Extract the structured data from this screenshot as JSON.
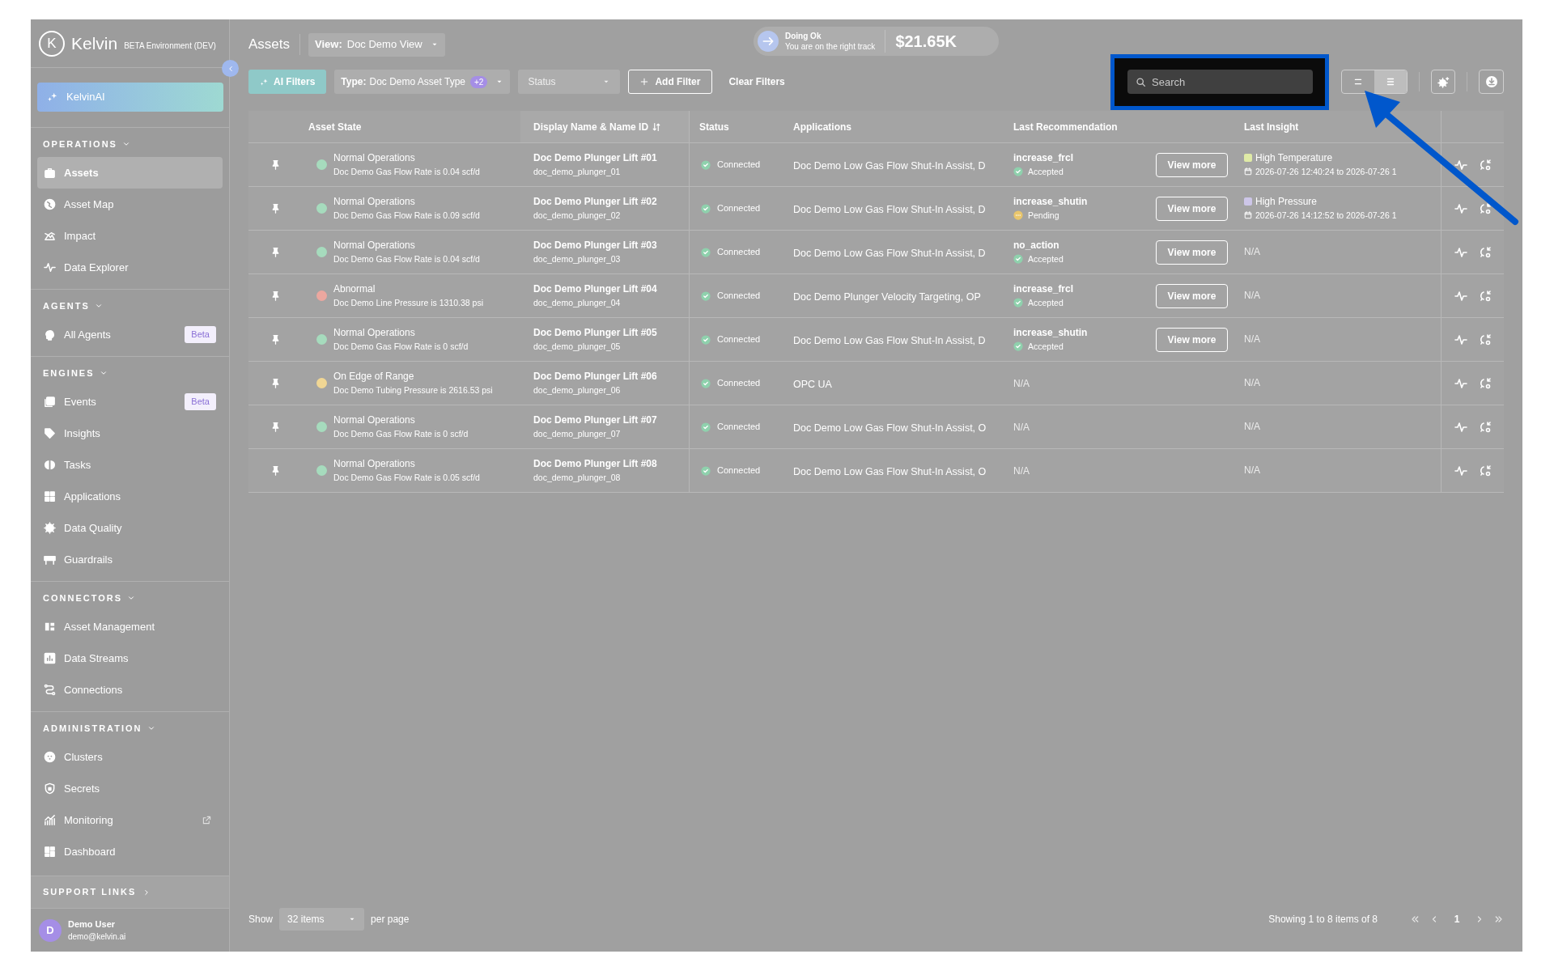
{
  "sidebar": {
    "logo": {
      "letter": "K",
      "name": "Kelvin",
      "environment": "BETA Environment (DEV)"
    },
    "ai_button": "KelvinAI",
    "sections": [
      {
        "title": "OPERATIONS",
        "items": [
          {
            "label": "Assets",
            "selected": true,
            "external": false
          },
          {
            "label": "Asset Map",
            "selected": false,
            "external": false
          },
          {
            "label": "Impact",
            "selected": false,
            "external": false
          },
          {
            "label": "Data Explorer",
            "selected": false,
            "external": false
          }
        ]
      },
      {
        "title": "AGENTS",
        "items": [
          {
            "label": "All Agents",
            "selected": false,
            "external": false,
            "badge": "Beta"
          }
        ]
      },
      {
        "title": "ENGINES",
        "items": [
          {
            "label": "Events",
            "selected": false,
            "external": false,
            "badge": "Beta"
          },
          {
            "label": "Insights",
            "selected": false,
            "external": false
          },
          {
            "label": "Tasks",
            "selected": false,
            "external": false
          },
          {
            "label": "Applications",
            "selected": false,
            "external": false
          },
          {
            "label": "Data Quality",
            "selected": false,
            "external": false
          },
          {
            "label": "Guardrails",
            "selected": false,
            "external": false
          }
        ]
      },
      {
        "title": "CONNECTORS",
        "items": [
          {
            "label": "Asset Management",
            "selected": false,
            "external": false
          },
          {
            "label": "Data Streams",
            "selected": false,
            "external": false
          },
          {
            "label": "Connections",
            "selected": false,
            "external": false
          }
        ]
      },
      {
        "title": "ADMINISTRATION",
        "items": [
          {
            "label": "Clusters",
            "selected": false,
            "external": false
          },
          {
            "label": "Secrets",
            "selected": false,
            "external": false
          },
          {
            "label": "Monitoring",
            "selected": false,
            "external": true
          },
          {
            "label": "Dashboard",
            "selected": false,
            "external": false
          }
        ]
      }
    ],
    "support_links": "SUPPORT LINKS",
    "user": {
      "initial": "D",
      "name": "Demo User",
      "email": "demo@kelvin.ai"
    }
  },
  "header": {
    "title": "Assets",
    "view": {
      "label": "View:",
      "value": "Doc Demo View"
    },
    "health": {
      "title": "Doing Ok",
      "subtitle": "You are on the right track",
      "amount": "$21.65K"
    }
  },
  "filters": {
    "ai": "AI Filters",
    "type": {
      "label": "Type:",
      "value": "Doc Demo Asset Type",
      "count": "+2"
    },
    "status": {
      "placeholder": "Status"
    },
    "add": "Add Filter",
    "clear": "Clear Filters"
  },
  "search": {
    "placeholder": "Search"
  },
  "view_toggle": [
    {
      "kind": "compact",
      "selected": false
    },
    {
      "kind": "list",
      "selected": true
    }
  ],
  "table": {
    "columns": [
      "Asset State",
      "Display Name & Name ID",
      "Status",
      "Applications",
      "Last Recommendation",
      "Last Insight"
    ],
    "rows": [
      {
        "state": "Normal Operations",
        "color": "#a6dbbd",
        "detail": "Doc Demo Gas Flow Rate is 0.04 scf/d",
        "name": "Doc Demo Plunger Lift #01",
        "id": "doc_demo_plunger_01",
        "status": "Connected",
        "applications": "Doc Demo Low Gas Flow Shut-In Assist, D",
        "recommendation": {
          "kind": "action",
          "action": "increase_frcl",
          "status": "Accepted",
          "pending": false,
          "button": "View more"
        },
        "insight": {
          "kind": "insight",
          "color": "#dfeaa6",
          "title": "High Temperature",
          "time": "2026-07-26 12:40:24 to 2026-07-26 1"
        }
      },
      {
        "state": "Normal Operations",
        "color": "#a6dbbd",
        "detail": "Doc Demo Gas Flow Rate is 0.09 scf/d",
        "name": "Doc Demo Plunger Lift #02",
        "id": "doc_demo_plunger_02",
        "status": "Connected",
        "applications": "Doc Demo Low Gas Flow Shut-In Assist, D",
        "recommendation": {
          "kind": "action",
          "action": "increase_shutin",
          "status": "Pending",
          "pending": true,
          "button": "View more"
        },
        "insight": {
          "kind": "insight",
          "color": "#cdc6e8",
          "title": "High Pressure",
          "time": "2026-07-26 14:12:52 to 2026-07-26 1"
        }
      },
      {
        "state": "Normal Operations",
        "color": "#a6dbbd",
        "detail": "Doc Demo Gas Flow Rate is 0.04 scf/d",
        "name": "Doc Demo Plunger Lift #03",
        "id": "doc_demo_plunger_03",
        "status": "Connected",
        "applications": "Doc Demo Low Gas Flow Shut-In Assist, D",
        "recommendation": {
          "kind": "action",
          "action": "no_action",
          "status": "Accepted",
          "pending": false,
          "button": "View more"
        },
        "insight": {
          "kind": "empty",
          "text": "N/A"
        }
      },
      {
        "state": "Abnormal",
        "color": "#eba79f",
        "detail": "Doc Demo Line Pressure is 1310.38 psi",
        "name": "Doc Demo Plunger Lift #04",
        "id": "doc_demo_plunger_04",
        "status": "Connected",
        "applications": "Doc Demo Plunger Velocity Targeting, OP",
        "recommendation": {
          "kind": "action",
          "action": "increase_frcl",
          "status": "Accepted",
          "pending": false,
          "button": "View more"
        },
        "insight": {
          "kind": "empty",
          "text": "N/A"
        }
      },
      {
        "state": "Normal Operations",
        "color": "#a6dbbd",
        "detail": "Doc Demo Gas Flow Rate is 0 scf/d",
        "name": "Doc Demo Plunger Lift #05",
        "id": "doc_demo_plunger_05",
        "status": "Connected",
        "applications": "Doc Demo Low Gas Flow Shut-In Assist, D",
        "recommendation": {
          "kind": "action",
          "action": "increase_shutin",
          "status": "Accepted",
          "pending": false,
          "button": "View more"
        },
        "insight": {
          "kind": "empty",
          "text": "N/A"
        }
      },
      {
        "state": "On Edge of Range",
        "color": "#f0d694",
        "detail": "Doc Demo Tubing Pressure is 2616.53 psi",
        "name": "Doc Demo Plunger Lift #06",
        "id": "doc_demo_plunger_06",
        "status": "Connected",
        "applications": "OPC UA",
        "recommendation": {
          "kind": "empty",
          "text": "N/A"
        },
        "insight": {
          "kind": "empty",
          "text": "N/A"
        }
      },
      {
        "state": "Normal Operations",
        "color": "#a6dbbd",
        "detail": "Doc Demo Gas Flow Rate is 0 scf/d",
        "name": "Doc Demo Plunger Lift #07",
        "id": "doc_demo_plunger_07",
        "status": "Connected",
        "applications": "Doc Demo Low Gas Flow Shut-In Assist, O",
        "recommendation": {
          "kind": "empty",
          "text": "N/A"
        },
        "insight": {
          "kind": "empty",
          "text": "N/A"
        }
      },
      {
        "state": "Normal Operations",
        "color": "#a6dbbd",
        "detail": "Doc Demo Gas Flow Rate is 0.05 scf/d",
        "name": "Doc Demo Plunger Lift #08",
        "id": "doc_demo_plunger_08",
        "status": "Connected",
        "applications": "Doc Demo Low Gas Flow Shut-In Assist, O",
        "recommendation": {
          "kind": "empty",
          "text": "N/A"
        },
        "insight": {
          "kind": "empty",
          "text": "N/A"
        }
      }
    ]
  },
  "footer": {
    "show": "Show",
    "per_page": "32 items",
    "per_page_suffix": "per page",
    "summary": "Showing 1 to 8 items of 8",
    "page": "1"
  }
}
